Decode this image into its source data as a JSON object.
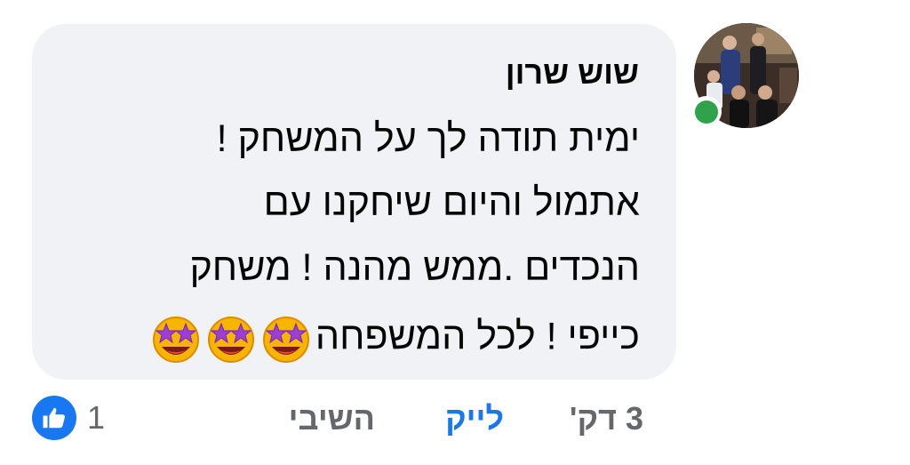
{
  "comment": {
    "author": "שוש שרון",
    "lines": [
      "ימית תודה לך על המשחק !",
      "אתמול והיום שיחקנו עם",
      "הנכדים .ממש מהנה ! משחק",
      "כייפי ! לכל המשפחה"
    ],
    "emojis": [
      "star-struck-emoji",
      "star-struck-emoji",
      "star-struck-emoji"
    ],
    "online": true
  },
  "actions": {
    "time": "3 דק'",
    "like": "לייק",
    "reply": "השיבי"
  },
  "reactions": {
    "icon": "thumbs-up-icon",
    "count": "1"
  },
  "colors": {
    "bubble": "#f0f2f5",
    "like": "#1877f2",
    "muted": "#65676b",
    "online": "#31a24c"
  }
}
